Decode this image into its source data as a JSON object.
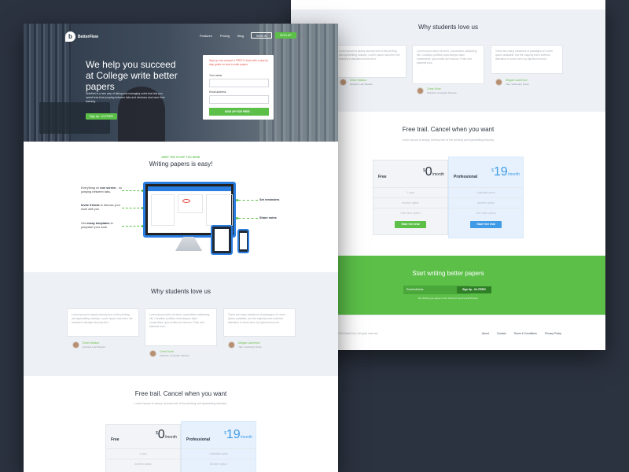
{
  "brand": {
    "name": "BetterFlow"
  },
  "nav": {
    "items": [
      "Features",
      "Pricing",
      "Blog"
    ],
    "signin": "SIGN IN",
    "signup": "SIGN UP"
  },
  "hero": {
    "title": "We help you succeed at College write better papers",
    "desc": "Notefirst is a new way of taking and managing notes that lets you spend less time jumping between tabs and windows and more time learning.",
    "button": "Sign Up - It's FREE!"
  },
  "form": {
    "hint": "Sign up now and get a FREE E-book with a step by step guide on how to write papers",
    "name_label": "Your name",
    "email_label": "Email address",
    "submit": "SIGN UP FOR FREE"
  },
  "features": {
    "kicker": "KEEP THE STUFF YOU NEED",
    "title": "Writing papers is easy!",
    "left": [
      {
        "bold": "one screen",
        "pre": "Everything on ",
        "post": " - no jumping between tabs."
      },
      {
        "bold": "Invite friends",
        "pre": "",
        "post": " to discuss your work with you"
      },
      {
        "bold": "essay templates",
        "pre": "Get ",
        "post": " to jumpstart your work"
      }
    ],
    "right": [
      "Set reminders",
      "Share notes"
    ]
  },
  "testimonials": {
    "title": "Why students love us",
    "items": [
      {
        "text": "Lorem ipsum is simply dummy text of the printing and typesetting industry. Lorem ipsum has been the industry's standard dummy text.",
        "name": "Drew Watson",
        "role": "Harvard, Law Student"
      },
      {
        "text": "Lorem ipsum dolor sit amet, consectetur adipiscing elit. Curabitur porttitor nulla tempus diam consectetur, quis mollis dui rhoncus. Proin sed placerat eros.",
        "name": "Chris Scott",
        "role": "Stanford, Computer Science"
      },
      {
        "text": "There are many variations of passages of Lorem ipsum available, but the majority have suffered alteration in some form, by injected humour.",
        "name": "Megan Lawrence",
        "role": "Yale, Veterinary Nurse"
      }
    ]
  },
  "pricing": {
    "title": "Free trail. Cancel when you want",
    "sub": "Lorem ipsum is simply dummy text of the printing and typesetting industry.",
    "free": {
      "name": "Free",
      "currency": "$",
      "price": "0",
      "per": "/month",
      "rows": [
        "1 user",
        "Another option",
        "One more option"
      ],
      "button": "Start free trial"
    },
    "pro": {
      "name": "Professional",
      "currency": "$",
      "price": "19",
      "per": "/month",
      "rows": [
        "Unlimited users",
        "Another option",
        "One more option"
      ],
      "button": "Start free trial"
    }
  },
  "cta": {
    "title": "Start writing better papers",
    "placeholder": "Email address",
    "button": "Sign Up - It's FREE!",
    "note": "By clicking you agree to the Terms of service and Privacy"
  },
  "footer": {
    "copy": "© 2016 BetterFlow. All rights reserved.",
    "links": [
      "About",
      "Contact",
      "Terms & Conditions",
      "Privacy Policy"
    ]
  },
  "colors": {
    "green": "#5bbf48",
    "blue": "#3f9be6",
    "bg": "#2c3340"
  }
}
